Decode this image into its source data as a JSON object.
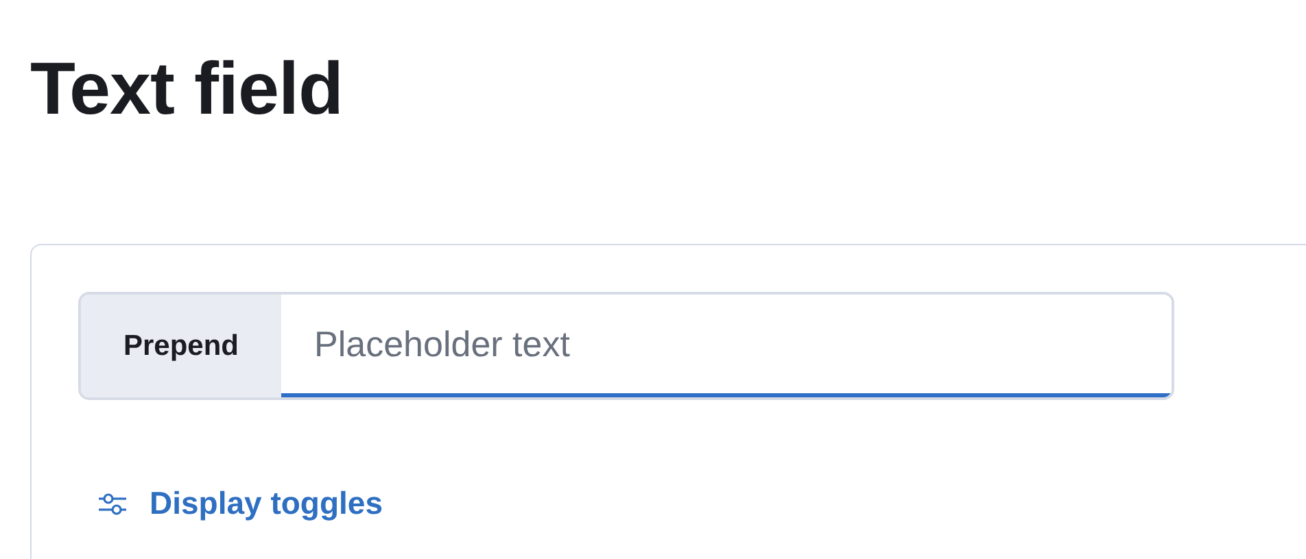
{
  "title": "Text field",
  "field": {
    "prepend": "Prepend",
    "placeholder": "Placeholder text",
    "focused": true
  },
  "link": {
    "label": "Display toggles"
  }
}
